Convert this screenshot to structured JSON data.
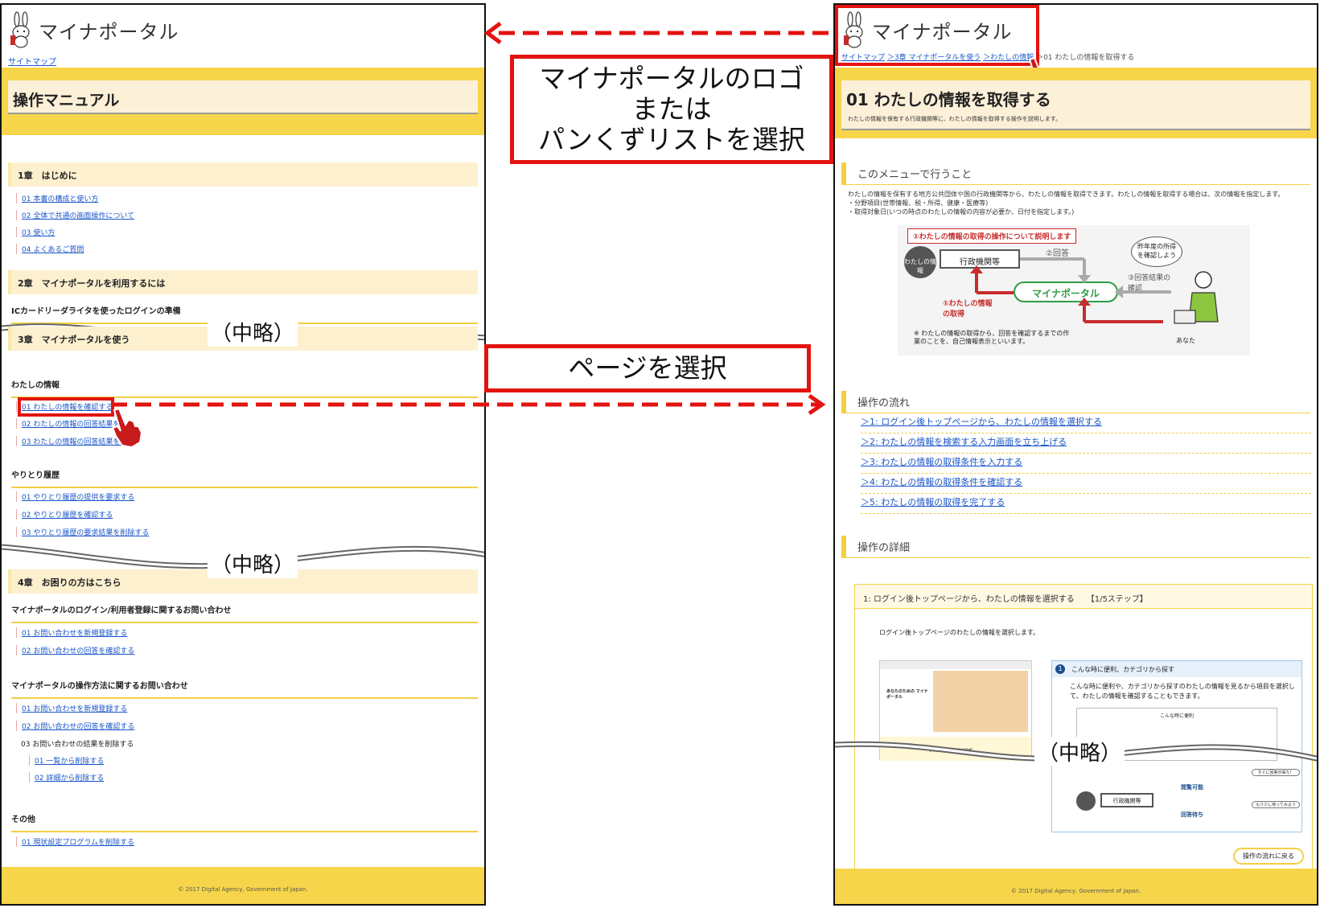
{
  "left_panel": {
    "logo_text": "マイナポータル",
    "sitemap": "サイトマップ",
    "page_title": "操作マニュアル",
    "chapter1": {
      "title": "1章　はじめに",
      "links": [
        "01 本書の構成と使い方",
        "02 全体で共通の画面操作について",
        "03 使い方",
        "04 よくあるご質問"
      ]
    },
    "chapter2": {
      "title": "2章　マイナポータルを利用するには",
      "sub": "ICカードリーダライタを使ったログインの準備"
    },
    "chapter3": {
      "title": "3章　マイナポータルを使う",
      "sub_info": "わたしの情報",
      "info_links": [
        "01 わたしの情報を確認する",
        "02 わたしの情報の回答結果を",
        "03 わたしの情報の回答結果を削"
      ],
      "sub_history": "やりとり履歴",
      "history_links": [
        "01 やりとり履歴の提供を要求する",
        "02 やりとり履歴を確認する",
        "03 やりとり履歴の要求結果を削除する"
      ]
    },
    "chapter4": {
      "title": "4章　お困りの方はこちら",
      "sub_login": "マイナポータルのログイン/利用者登録に関するお問い合わせ",
      "login_links": [
        "01 お問い合わせを新規登録する",
        "02 お問い合わせの回答を確認する"
      ],
      "sub_ops": "マイナポータルの操作方法に関するお問い合わせ",
      "ops_links": [
        "01 お問い合わせを新規登録する",
        "02 お問い合わせの回答を確認する"
      ],
      "ops_plain": "03 お問い合わせの結果を削除する",
      "ops_sublinks": [
        "01 一覧から削除する",
        "02 詳細から削除する"
      ],
      "sub_other": "その他",
      "other_links": [
        "01 現状設定プログラムを削除する"
      ]
    },
    "omit_label_1": "（中略）",
    "omit_label_2": "（中略）",
    "footer": "© 2017 Digital Agency, Government of Japan."
  },
  "callouts": {
    "logo_or_breadcrumb": [
      "マイナポータルのロゴ",
      "または",
      "パンくずリストを選択"
    ],
    "select_page": "ページを選択"
  },
  "right_panel": {
    "logo_text": "マイナポータル",
    "breadcrumb": [
      "サイトマップ",
      "＞3章 マイナポータルを使う",
      "＞わたしの情報",
      "＞01 わたしの情報を取得する"
    ],
    "page_title": "01 わたしの情報を取得する",
    "page_subtitle": "わたしの情報を保有する行政機関等に、わたしの情報を取得する操作を説明します。",
    "menu_heading": "このメニューで行うこと",
    "menu_text": [
      "わたしの情報を保有する地方公共団体や国の行政機関等から、わたしの情報を取得できます。わたしの情報を取得する場合は、次の情報を指定します。",
      "・分野項目(世帯情報、税・所得、健康・医療等)",
      "・取得対象日(いつの時点のわたしの情報の内容が必要か、日付を指定します。)"
    ],
    "diagram": {
      "caption": "①わたしの情報の取得の操作について説明します",
      "agency": "行政機関等",
      "portal": "マイナポータル",
      "info_label": "わたしの情報",
      "step1": "①わたしの情報の取得",
      "step2": "②回答",
      "step3": "③回答結果の確認",
      "bubble": "昨年度の所得を確認しよう",
      "you": "あなた",
      "note": "※ わたしの情報の取得から、回答を確認するまでの作業のことを、自己情報表示といいます。"
    },
    "flow_heading": "操作の流れ",
    "flow_links": [
      "＞1: ログイン後トップページから、わたしの情報を選択する",
      "＞2: わたしの情報を検索する入力画面を立ち上げる",
      "＞3: わたしの情報の取得条件を入力する",
      "＞4: わたしの情報の取得条件を確認する",
      "＞5: わたしの情報の取得を完了する"
    ],
    "detail_heading": "操作の詳細",
    "step_title": "1: ログイン後トップページから、わたしの情報を選択する　　【1/5ステップ】",
    "step_text": "ログイン後トップページのわたしの情報を選択します。",
    "tip_title": "こんな時に便利、カテゴリから探す",
    "tip_text": "こんな時に便利や、カテゴリから探すのわたしの情報を見るから項目を選択して、わたしの情報を確認することもできます。",
    "tip_inner_title": "こんな時に便利",
    "thumb_title": "あなたのための マイナポータル",
    "thumb_bar": "マイナ之さんの保健情報",
    "diagram2": {
      "agency": "行政機関等",
      "viewable": "閲覧可能",
      "waiting": "回答待ち",
      "bubble1": "すぐに回答が来た！",
      "bubble2": "もう少し待ってみよう"
    },
    "omit_label": "（中略）",
    "back_button": "操作の流れに戻る",
    "footer": "© 2017 Digital Agency, Government of Japan."
  },
  "colors": {
    "accent_yellow": "#f6d54a",
    "title_bg": "#fdf0d9",
    "callout_red": "#e3130f",
    "link_blue": "#1a55c8",
    "portal_green": "#2f9b43"
  }
}
